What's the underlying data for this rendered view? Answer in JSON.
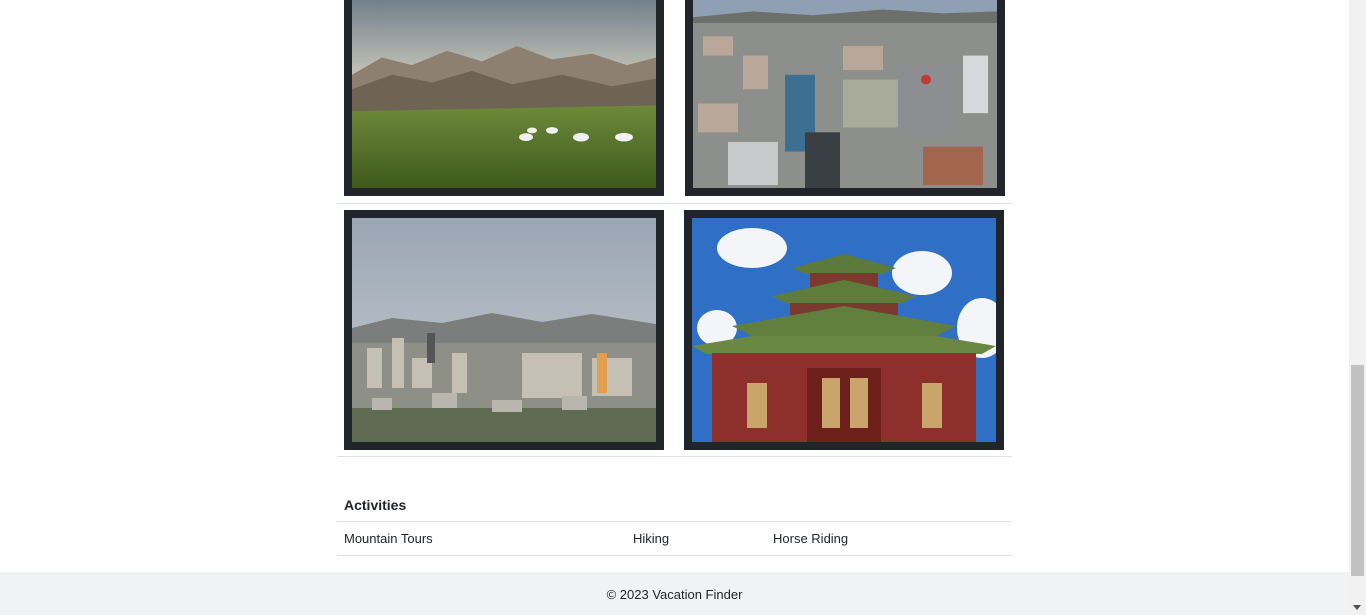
{
  "activities": {
    "heading": "Activities",
    "items": [
      "Mountain Tours",
      "Hiking",
      "Horse Riding"
    ]
  },
  "footer": {
    "text": "© 2023 Vacation Finder"
  },
  "gallery": {
    "photos": [
      {
        "subject": "steppe-with-gers"
      },
      {
        "subject": "city-aerial-view"
      },
      {
        "subject": "city-skyline-mountains"
      },
      {
        "subject": "temple-gate"
      }
    ]
  },
  "colors": {
    "frame": "#212529",
    "footer_bg": "#f1f2f3",
    "divider": "#dee2e6"
  }
}
